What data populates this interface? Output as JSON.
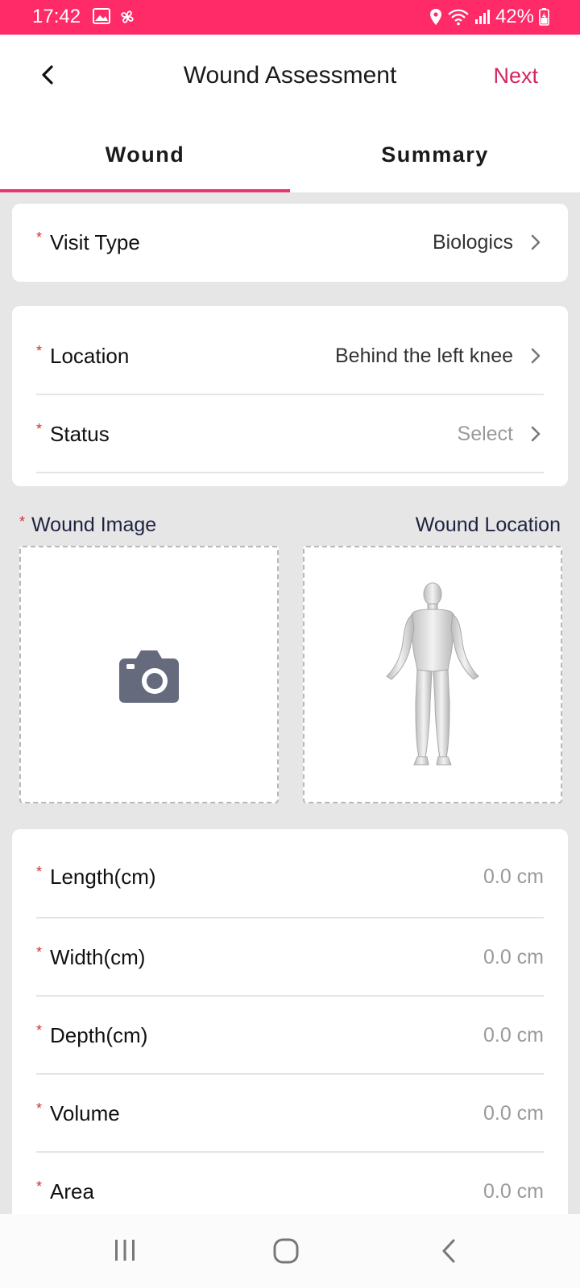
{
  "status_bar": {
    "time": "17:42",
    "battery": "42%"
  },
  "header": {
    "title": "Wound Assessment",
    "next_label": "Next"
  },
  "tabs": [
    {
      "label": "Wound"
    },
    {
      "label": "Summary"
    }
  ],
  "visit": {
    "label": "Visit Type",
    "value": "Biologics"
  },
  "location": {
    "label": "Location",
    "value": "Behind the left knee"
  },
  "status": {
    "label": "Status",
    "placeholder": "Select"
  },
  "images": {
    "wound_image_label": "Wound Image",
    "wound_location_label": "Wound Location"
  },
  "measurements": [
    {
      "label": "Length(cm)",
      "placeholder": "0.0 cm"
    },
    {
      "label": "Width(cm)",
      "placeholder": "0.0 cm"
    },
    {
      "label": "Depth(cm)",
      "placeholder": "0.0 cm"
    },
    {
      "label": "Volume",
      "placeholder": "0.0 cm"
    },
    {
      "label": "Area",
      "placeholder": "0.0 cm"
    }
  ],
  "colors": {
    "accent": "#ff2a68",
    "next": "#d4265e",
    "required": "#d32f2f"
  }
}
